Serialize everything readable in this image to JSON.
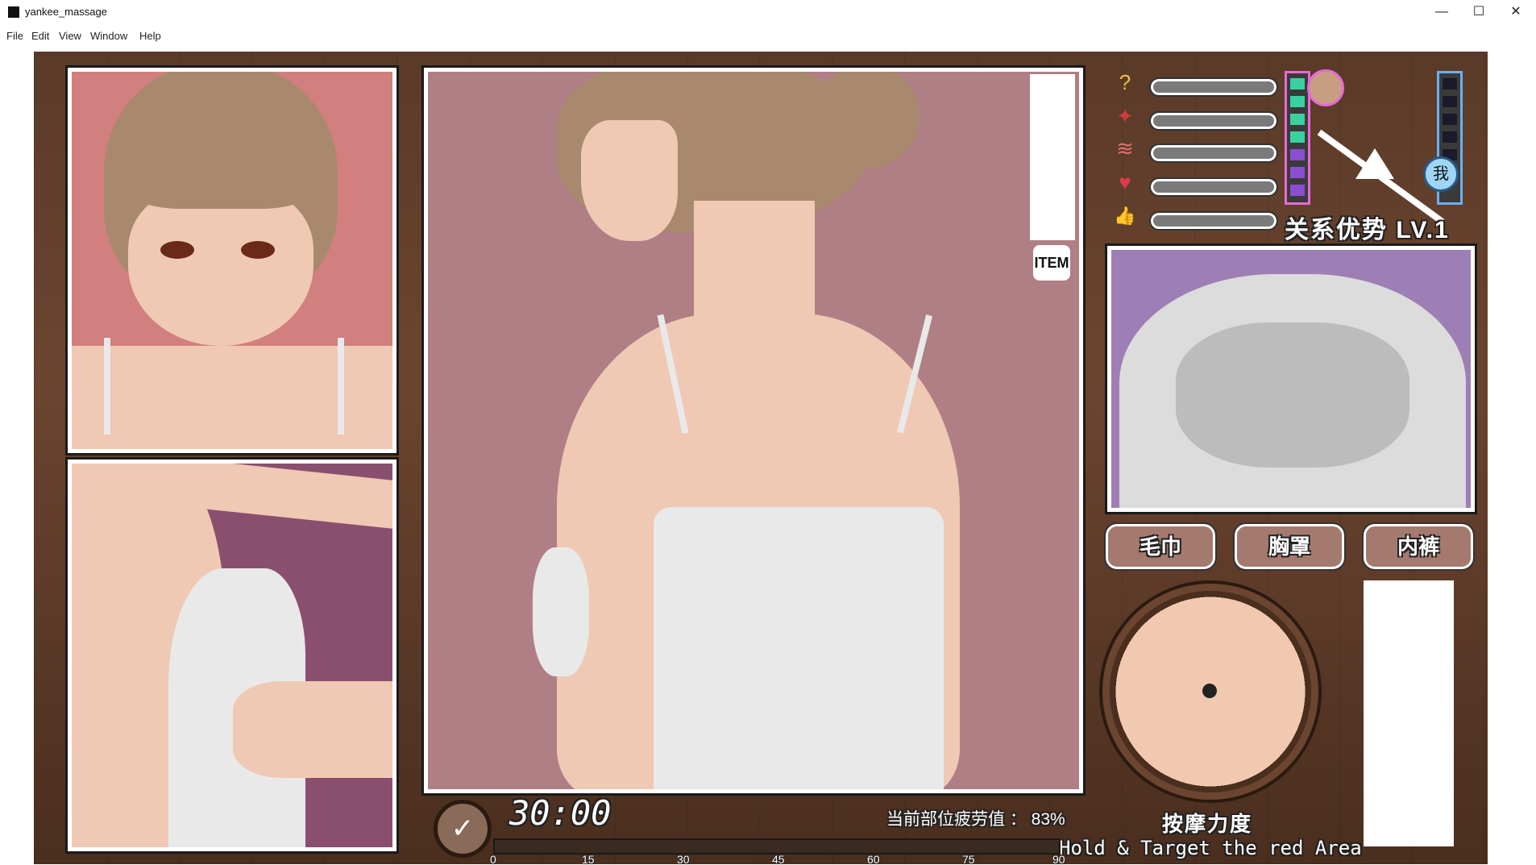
{
  "window": {
    "title": "yankee_massage",
    "minimize": "—",
    "maximize": "☐",
    "close": "✕"
  },
  "menu": [
    "File",
    "Edit",
    "View",
    "Window",
    "Help"
  ],
  "hud": {
    "item_label": "ITEM",
    "stats": [
      {
        "icon": "question-icon",
        "glyph": "?",
        "color": "#e8c04a"
      },
      {
        "icon": "anger-icon",
        "glyph": "✦",
        "color": "#d23a3a"
      },
      {
        "icon": "steam-icon",
        "glyph": "≋",
        "color": "#e07070"
      },
      {
        "icon": "heart-icon",
        "glyph": "♥",
        "color": "#e03a4a"
      },
      {
        "icon": "thumbs-up-icon",
        "glyph": "👍",
        "color": "#3a8ad6"
      }
    ],
    "relation_level": "关系优势 LV.1",
    "me_label": "我",
    "clothing_buttons": [
      "毛巾",
      "胸罩",
      "内裤"
    ],
    "massage_strength_label": "按摩力度",
    "hint": "Hold & Target the red Area",
    "timer": "30:00",
    "fatigue_label": "当前部位疲劳值 ： 83%",
    "progress_ticks": [
      "0",
      "15",
      "30",
      "45",
      "60",
      "75",
      "90"
    ]
  }
}
